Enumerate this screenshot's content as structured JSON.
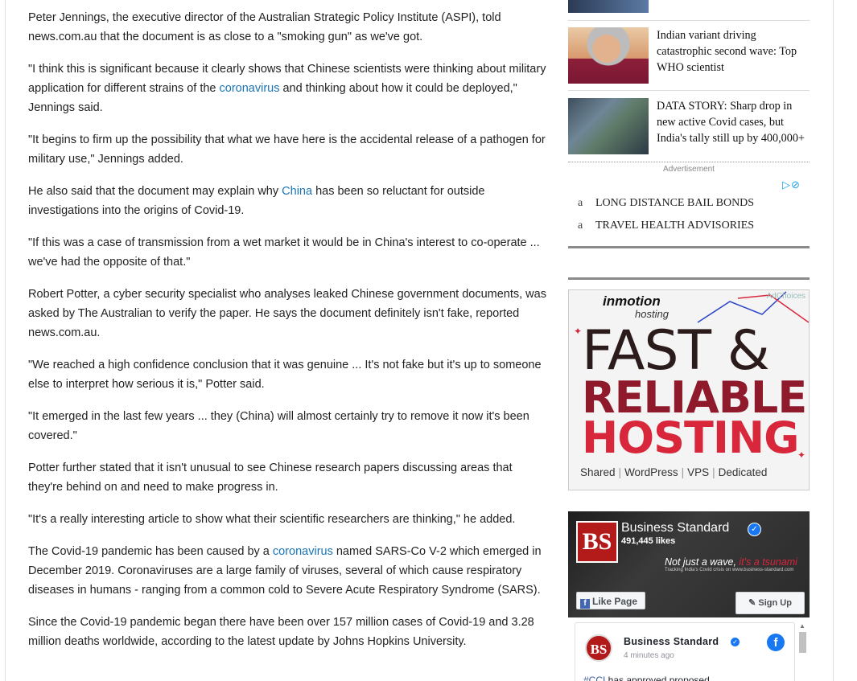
{
  "article": {
    "paragraphs": [
      {
        "parts": [
          "Peter Jennings, the executive director of the Australian Strategic Policy Institute (ASPI), told news.com.au that the document is as close to a \"smoking gun\" as we've got."
        ]
      },
      {
        "parts": [
          "\"I think this is significant because it clearly shows that Chinese scientists were thinking about military application for different strains of the ",
          {
            "link": "coronavirus"
          },
          " and thinking about how it could be deployed,\" Jennings said."
        ]
      },
      {
        "parts": [
          "\"It begins to firm up the possibility that what we have here is the accidental release of a pathogen for military use,\" Jennings added."
        ]
      },
      {
        "parts": [
          "He also said that the document may explain why ",
          {
            "link": "China"
          },
          " has been so reluctant for outside investigations into the origins of Covid-19."
        ]
      },
      {
        "parts": [
          "\"If this was a case of transmission from a wet market it would be in China's interest to co-operate ... we've had the opposite of that.\""
        ]
      },
      {
        "parts": [
          "Robert Potter, a cyber security specialist who analyses leaked Chinese government documents, was asked by The Australian to verify the paper. He says the document definitely isn't fake, reported news.com.au."
        ]
      },
      {
        "parts": [
          "\"We reached a high confidence conclusion that it was genuine ... It's not fake but it's up to someone else to interpret how serious it is,\" Potter said."
        ]
      },
      {
        "parts": [
          "\"It emerged in the last few years ... they (China) will almost certainly try to remove it now it's been covered.\""
        ]
      },
      {
        "parts": [
          "Potter further stated that it isn't unusual to see Chinese research papers discussing areas that they're behind on and need to make progress in."
        ]
      },
      {
        "parts": [
          "\"It's a really interesting article to show what their scientific researchers are thinking,\" he added."
        ]
      },
      {
        "parts": [
          "The Covid-19 pandemic has been caused by a ",
          {
            "link": "coronavirus"
          },
          " named SARS-Co V-2 which emerged in December 2019. Coronaviruses are a large family of viruses, several of which cause respiratory diseases in humans - ranging from a common cold to Severe Acute Respiratory Syndrome (SARS)."
        ]
      },
      {
        "parts": [
          "Since the Covid-19 pandemic began there have been over 157 million cases of Covid-19 and 3.28 million deaths worldwide, according to the latest update by Johns Hopkins University."
        ]
      }
    ]
  },
  "sidebar": {
    "stories": [
      {
        "title": "Indian variant driving catastrophic second wave: Top WHO scientist"
      },
      {
        "title": "DATA STORY: Sharp drop in new active Covid cases, but India's tally still up by 400,000+"
      }
    ],
    "advertisement_label": "Advertisement",
    "ad_links": [
      {
        "bullet": "a",
        "text": "LONG DISTANCE BAIL BONDS"
      },
      {
        "bullet": "a",
        "text": "TRAVEL HEALTH ADVISORIES"
      }
    ],
    "hosting_ad": {
      "brand": "inmotion",
      "brand_sub": "hosting",
      "adchoices": "AdChoices",
      "line1": "FAST &",
      "line2": "RELIABLE",
      "line3": "HOSTING",
      "footer": [
        "Shared",
        "WordPress",
        "VPS",
        "Dedicated"
      ]
    },
    "facebook": {
      "logo_text": "BS",
      "page_name": "Business Standard",
      "likes": "491,445 likes",
      "tagline_a": "Not just a wave, ",
      "tagline_b": "it's a tsunami",
      "tagline_sub": "Tracking India's Covid crisis on www.business-standard.com",
      "like_button": "Like Page",
      "signup_button": "Sign Up",
      "post_author": "Business Standard",
      "post_time": "4 minutes ago",
      "post_text_tag": "#CCI",
      "post_text": " has approved proposed"
    }
  }
}
